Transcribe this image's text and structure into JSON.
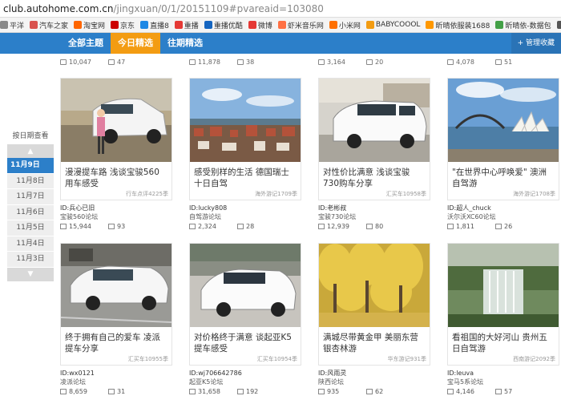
{
  "url": {
    "host": "club.autohome.com.cn",
    "path": "/jingxuan/0/1/20151109#pvareaid=103080"
  },
  "bookmarks": [
    {
      "label": "平洋",
      "color": "#888"
    },
    {
      "label": "汽车之家",
      "color": "#d9534f"
    },
    {
      "label": "淘宝网",
      "color": "#ff6600"
    },
    {
      "label": "京东",
      "color": "#c00"
    },
    {
      "label": "直播8",
      "color": "#1e88e5"
    },
    {
      "label": "重播",
      "color": "#e53935"
    },
    {
      "label": "重播优酷",
      "color": "#1565c0"
    },
    {
      "label": "微博",
      "color": "#e53935"
    },
    {
      "label": "虾米音乐网",
      "color": "#ff7043"
    },
    {
      "label": "小米网",
      "color": "#ff6f00"
    },
    {
      "label": "BABYCOOOL",
      "color": "#f39c12"
    },
    {
      "label": "昕晴依服装1688",
      "color": "#ff9800"
    },
    {
      "label": "昕晴依-数据包",
      "color": "#43a047"
    },
    {
      "label": "新科技-飞利浦",
      "color": "#555"
    }
  ],
  "nav": {
    "tabs": [
      {
        "label": "全部主题",
        "active": false
      },
      {
        "label": "今日精选",
        "active": true
      },
      {
        "label": "往期精选",
        "active": false
      }
    ],
    "manage": "+ 管理收藏"
  },
  "sidebar": {
    "title": "按日期查看",
    "dates": [
      "11月9日",
      "11月8日",
      "11月7日",
      "11月6日",
      "11月5日",
      "11月4日",
      "11月3日"
    ]
  },
  "top_partial": [
    {
      "views": "10,047",
      "replies": "47"
    },
    {
      "views": "11,878",
      "replies": "38"
    },
    {
      "views": "3,164",
      "replies": "20"
    },
    {
      "views": "4,078",
      "replies": "51"
    }
  ],
  "cards": [
    {
      "title": "漫漫提车路 浅谈宝骏560用车感受",
      "tag": "行车点评4225季",
      "user": "ID:兵心已旧",
      "forum": "宝骏560论坛",
      "views": "15,944",
      "replies": "93"
    },
    {
      "title": "感受别样的生活 德国瑞士十日自驾",
      "tag": "海外游记1709季",
      "user": "ID:lucky808",
      "forum": "自驾游论坛",
      "views": "2,324",
      "replies": "28"
    },
    {
      "title": "对性价比满意 浅谈宝骏730购车分享",
      "tag": "汇买车10958季",
      "user": "ID:老彬叔",
      "forum": "宝骏730论坛",
      "views": "12,939",
      "replies": "80"
    },
    {
      "title": "\"在世界中心呼唤爱\" 澳洲自驾游",
      "tag": "海外游记1708季",
      "user": "ID:超人_chuck",
      "forum": "沃尔沃XC60论坛",
      "views": "1,811",
      "replies": "26"
    },
    {
      "title": "终于拥有自己的爱车 凌派提车分享",
      "tag": "汇买车10955季",
      "user": "ID:wx0121",
      "forum": "凌派论坛",
      "views": "8,659",
      "replies": "31"
    },
    {
      "title": "对价格终于满意 谈起亚K5提车感受",
      "tag": "汇买车10954季",
      "user": "ID:wj706642786",
      "forum": "起亚K5论坛",
      "views": "31,658",
      "replies": "192"
    },
    {
      "title": "满城尽带黄金甲 美丽东营银杏林游",
      "tag": "华东游记931季",
      "user": "ID:风雨灵",
      "forum": "陕西论坛",
      "views": "935",
      "replies": "62"
    },
    {
      "title": "看祖国的大好河山 贵州五日自驾游",
      "tag": "西南游记2092季",
      "user": "ID:leuva",
      "forum": "宝马5系论坛",
      "views": "4,146",
      "replies": "57"
    }
  ]
}
